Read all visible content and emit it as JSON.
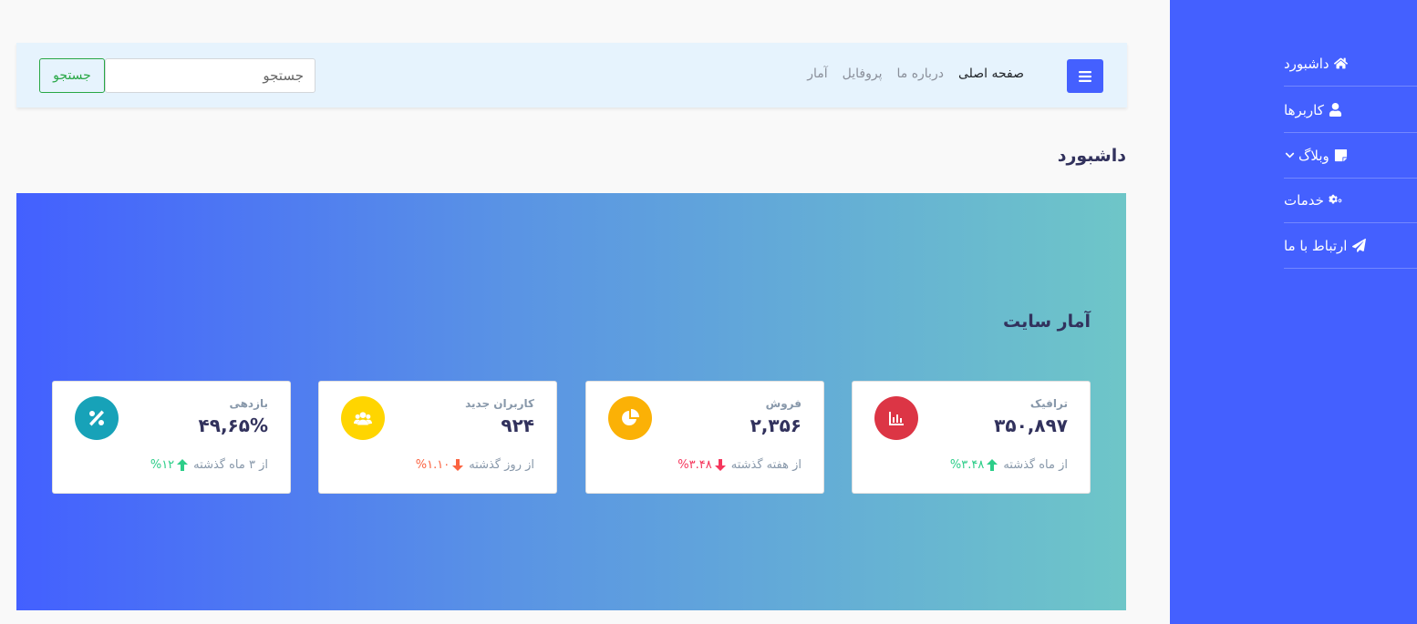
{
  "sidebar": {
    "items": [
      {
        "label": "داشبورد",
        "icon": "home-icon"
      },
      {
        "label": "کاربرها",
        "icon": "user-icon"
      },
      {
        "label": "وبلاگ",
        "icon": "sticky-note-icon",
        "has_submenu": true
      },
      {
        "label": "خدمات",
        "icon": "cogs-icon"
      },
      {
        "label": "ارتباط با ما",
        "icon": "paper-plane-icon"
      }
    ]
  },
  "navbar": {
    "links": [
      {
        "label": "صفحه اصلی",
        "active": true
      },
      {
        "label": "درباره ما"
      },
      {
        "label": "پروفایل"
      },
      {
        "label": "آمار"
      }
    ],
    "search_placeholder": "جستجو",
    "search_button": "جستجو"
  },
  "page": {
    "title": "داشبورد",
    "stats_title": "آمار سایت"
  },
  "stats": [
    {
      "label": "ترافیک",
      "value": "۳۵۰,۸۹۷",
      "icon": "chart-bar-icon",
      "icon_color": "#dc3545",
      "delta": "%۳.۴۸",
      "direction": "up",
      "delta_color": "#2dce89",
      "since": "از ماه گذشته"
    },
    {
      "label": "فروش",
      "value": "۲,۳۵۶",
      "icon": "chart-pie-icon",
      "icon_color": "#fbb106",
      "delta": "%۳.۴۸",
      "direction": "down",
      "delta_color": "#f5365c",
      "since": "از هفته گذشته"
    },
    {
      "label": "کاربران جدید",
      "value": "۹۲۴",
      "icon": "users-icon",
      "icon_color": "#ffd500",
      "delta": "%۱.۱۰",
      "direction": "down",
      "delta_color": "#fb6340",
      "since": "از روز گذشته"
    },
    {
      "label": "بازدهی",
      "value": "۴۹,۶۵%",
      "icon": "percent-icon",
      "icon_color": "#17a2b8",
      "delta": "%۱۲",
      "direction": "up",
      "delta_color": "#2dce89",
      "since": "از ۳ ماه گذشته"
    }
  ],
  "colors": {
    "sidebar_bg": "#4460ff",
    "accent": "#4460ff",
    "navbar_bg": "#e6f3fd",
    "search_button": "#28a745"
  }
}
